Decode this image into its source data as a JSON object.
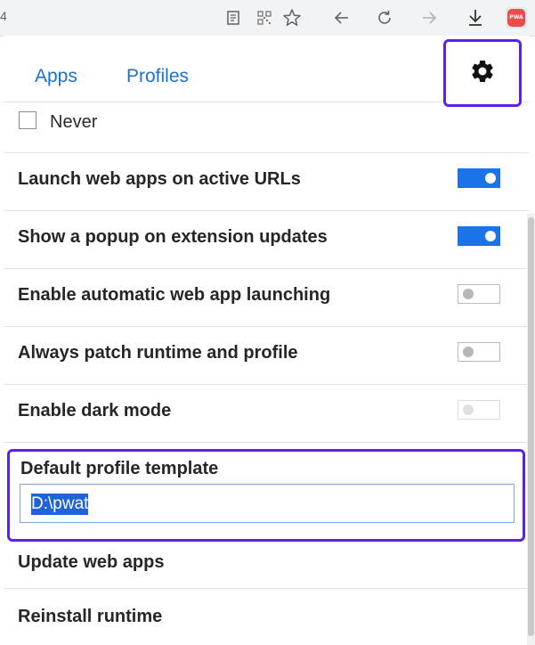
{
  "toolbar": {
    "left_fragment": "4",
    "icons": [
      "reader-mode-icon",
      "qr-code-icon",
      "bookmark-star-icon",
      "back-arrow-icon",
      "reload-icon",
      "forward-arrow-icon",
      "download-icon",
      "pwa-extension-icon"
    ],
    "extension_badge": "PWA",
    "background": "#f1f3f4"
  },
  "tabs": {
    "apps_label": "Apps",
    "profiles_label": "Profiles",
    "settings_icon": "gear-icon",
    "link_color": "#1a73c9",
    "highlight_color": "#5b21e8"
  },
  "never": {
    "label": "Never",
    "checked": false
  },
  "settings": [
    {
      "label": "Launch web apps on active URLs",
      "enabled": true
    },
    {
      "label": "Show a popup on extension updates",
      "enabled": true
    },
    {
      "label": "Enable automatic web app launching",
      "enabled": false
    },
    {
      "label": "Always patch runtime and profile",
      "enabled": false
    },
    {
      "label": "Enable dark mode",
      "enabled": false,
      "disabled": true
    }
  ],
  "template": {
    "label": "Default profile template",
    "value": "D:\\pwat"
  },
  "actions": {
    "update_label": "Update web apps",
    "reinstall_label": "Reinstall runtime"
  },
  "colors": {
    "toggle_on": "#1a73e8",
    "highlight": "#5b21e8"
  }
}
